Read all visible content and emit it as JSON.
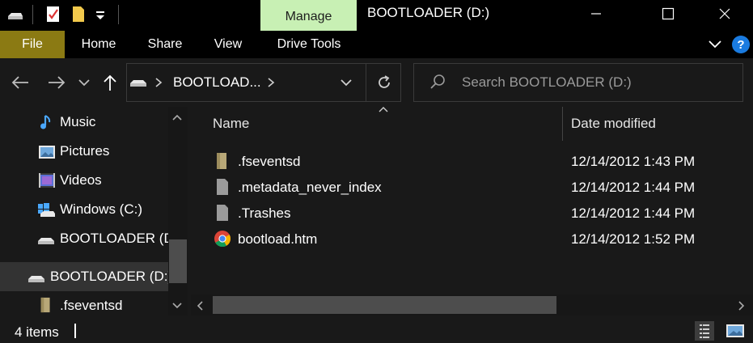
{
  "window": {
    "title": "BOOTLOADER (D:)",
    "context_tab": "Manage",
    "minimize": "—",
    "maximize": "☐",
    "close": "✕"
  },
  "ribbon": {
    "tabs": [
      "File",
      "Home",
      "Share",
      "View",
      "Drive Tools"
    ],
    "help": "?"
  },
  "nav": {
    "breadcrumb": "BOOTLOAD...",
    "search_placeholder": "Search BOOTLOADER (D:)"
  },
  "tree": [
    {
      "label": "Music",
      "icon": "music-icon"
    },
    {
      "label": "Pictures",
      "icon": "pictures-icon"
    },
    {
      "label": "Videos",
      "icon": "videos-icon"
    },
    {
      "label": "Windows (C:)",
      "icon": "windows-drive-icon"
    },
    {
      "label": "BOOTLOADER (D:)",
      "icon": "drive-icon"
    },
    {
      "label": "BOOTLOADER (D:)",
      "icon": "drive-icon",
      "selected": true
    },
    {
      "label": ".fseventsd",
      "icon": "folder-icon"
    }
  ],
  "columns": {
    "name": "Name",
    "date": "Date modified"
  },
  "files": [
    {
      "name": ".fseventsd",
      "date": "12/14/2012 1:43 PM",
      "icon": "folder-icon"
    },
    {
      "name": ".metadata_never_index",
      "date": "12/14/2012 1:44 PM",
      "icon": "file-icon"
    },
    {
      "name": ".Trashes",
      "date": "12/14/2012 1:44 PM",
      "icon": "file-icon"
    },
    {
      "name": "bootload.htm",
      "date": "12/14/2012 1:52 PM",
      "icon": "chrome-icon"
    }
  ],
  "status": {
    "count": "4 items"
  },
  "colors": {
    "file_tab": "#8b7a13",
    "manage_tab": "#c8f0b4",
    "folder": "#b8a878",
    "help": "#1a7be0"
  }
}
